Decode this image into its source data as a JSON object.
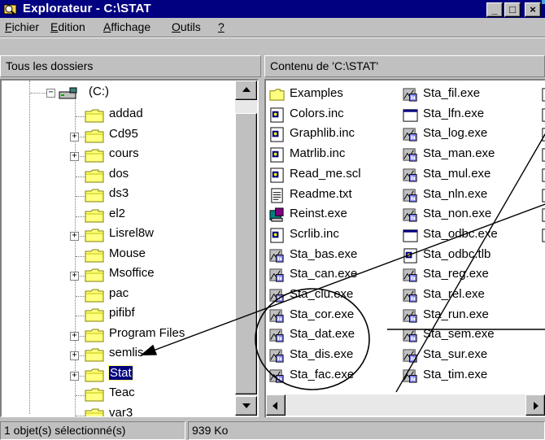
{
  "window": {
    "title": "Explorateur - C:\\STAT",
    "minimize": "_",
    "maximize": "□",
    "close": "×"
  },
  "menu": [
    {
      "label": "Fichier"
    },
    {
      "label": "Edition"
    },
    {
      "label": "Affichage"
    },
    {
      "label": "Outils"
    },
    {
      "label": "?"
    }
  ],
  "tree_header": "Tous les dossiers",
  "content_header": "Contenu de 'C:\\STAT'",
  "tree": {
    "root": "(C:)",
    "items": [
      {
        "label": "addad",
        "expandable": false
      },
      {
        "label": "Cd95",
        "expandable": true
      },
      {
        "label": "cours",
        "expandable": true
      },
      {
        "label": "dos",
        "expandable": false
      },
      {
        "label": "ds3",
        "expandable": false
      },
      {
        "label": "el2",
        "expandable": false
      },
      {
        "label": "Lisrel8w",
        "expandable": true
      },
      {
        "label": "Mouse",
        "expandable": false
      },
      {
        "label": "Msoffice",
        "expandable": true
      },
      {
        "label": "pac",
        "expandable": false
      },
      {
        "label": "pifibf",
        "expandable": false
      },
      {
        "label": "Program Files",
        "expandable": true
      },
      {
        "label": "semlis",
        "expandable": true
      },
      {
        "label": "Stat",
        "expandable": true,
        "selected": true
      },
      {
        "label": "Teac",
        "expandable": false
      },
      {
        "label": "var3",
        "expandable": false
      }
    ]
  },
  "files_col1": [
    {
      "name": "Examples",
      "icon": "folder-icon"
    },
    {
      "name": "Colors.inc",
      "icon": "inc-file-icon"
    },
    {
      "name": "Graphlib.inc",
      "icon": "inc-file-icon"
    },
    {
      "name": "Matrlib.inc",
      "icon": "inc-file-icon"
    },
    {
      "name": "Read_me.scl",
      "icon": "scl-file-icon"
    },
    {
      "name": "Readme.txt",
      "icon": "text-file-icon"
    },
    {
      "name": "Reinst.exe",
      "icon": "setup-exe-icon"
    },
    {
      "name": "Scrlib.inc",
      "icon": "inc-file-icon"
    },
    {
      "name": "Sta_bas.exe",
      "icon": "stat-exe-icon"
    },
    {
      "name": "Sta_can.exe",
      "icon": "stat-exe-icon"
    },
    {
      "name": "Sta_clu.exe",
      "icon": "stat-exe-icon"
    },
    {
      "name": "Sta_cor.exe",
      "icon": "stat-exe-icon"
    },
    {
      "name": "Sta_dat.exe",
      "icon": "stat-exe-icon"
    },
    {
      "name": "Sta_dis.exe",
      "icon": "stat-exe-icon"
    },
    {
      "name": "Sta_fac.exe",
      "icon": "stat-exe-icon"
    }
  ],
  "files_col2": [
    {
      "name": "Sta_fil.exe",
      "icon": "stat-exe-icon"
    },
    {
      "name": "Sta_lfn.exe",
      "icon": "window-exe-icon"
    },
    {
      "name": "Sta_log.exe",
      "icon": "stat-exe-icon"
    },
    {
      "name": "Sta_man.exe",
      "icon": "stat-exe-icon"
    },
    {
      "name": "Sta_mul.exe",
      "icon": "stat-exe-icon"
    },
    {
      "name": "Sta_nln.exe",
      "icon": "stat-exe-icon"
    },
    {
      "name": "Sta_non.exe",
      "icon": "stat-exe-icon"
    },
    {
      "name": "Sta_odbc.exe",
      "icon": "window-exe-icon"
    },
    {
      "name": "Sta_odbc.tlb",
      "icon": "inc-file-icon"
    },
    {
      "name": "Sta_reg.exe",
      "icon": "stat-exe-icon"
    },
    {
      "name": "Sta_rel.exe",
      "icon": "stat-exe-icon"
    },
    {
      "name": "Sta_run.exe",
      "icon": "stat-exe-icon"
    },
    {
      "name": "Sta_sem.exe",
      "icon": "stat-exe-icon"
    },
    {
      "name": "Sta_sur.exe",
      "icon": "stat-exe-icon"
    },
    {
      "name": "Sta_tim.exe",
      "icon": "stat-exe-icon"
    }
  ],
  "status": {
    "selection": "1 objet(s) sélectionné(s)",
    "size": "939 Ko"
  }
}
